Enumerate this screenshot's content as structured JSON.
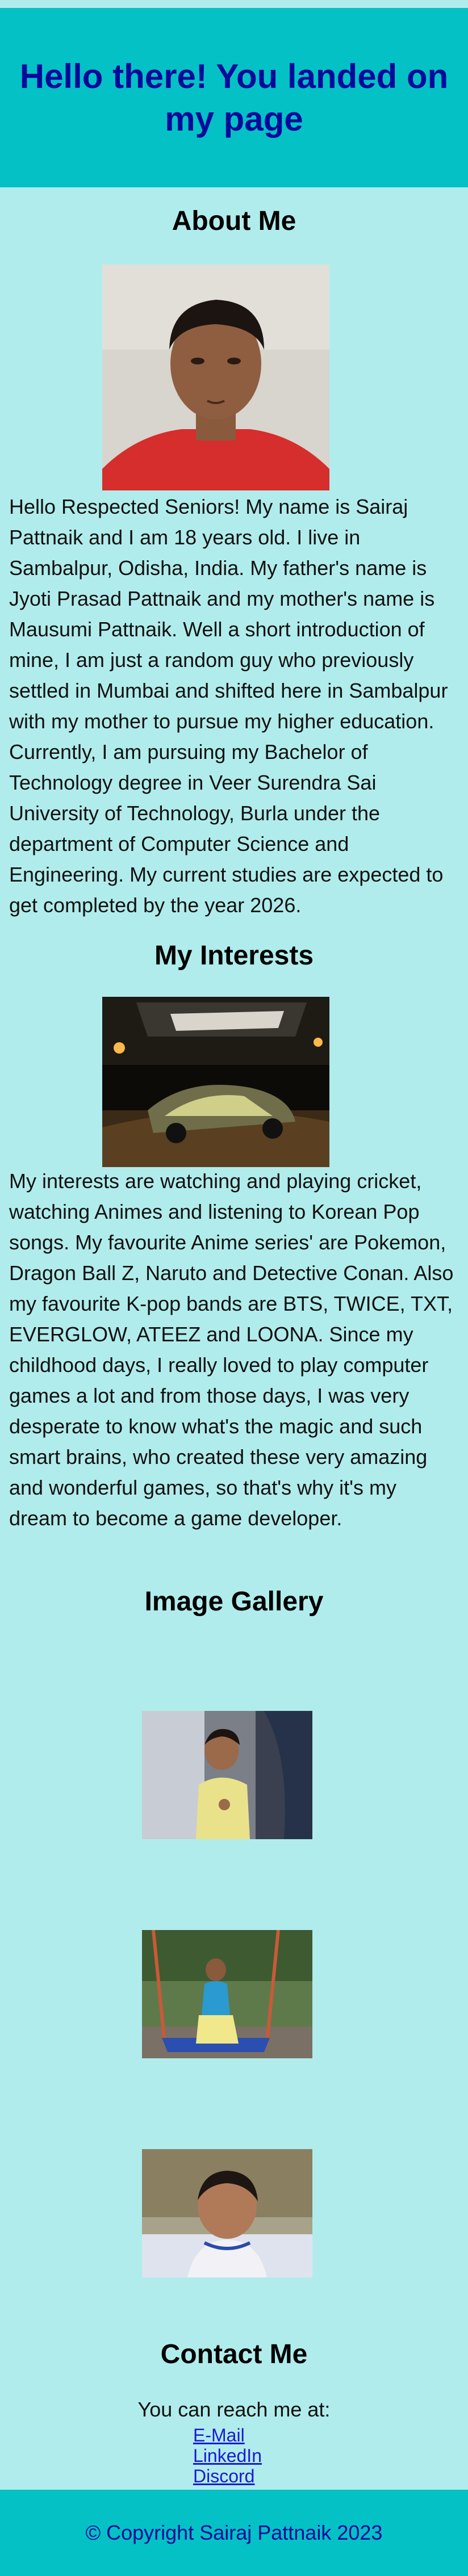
{
  "header": {
    "title": "Hello there! You landed on my page"
  },
  "about": {
    "heading": "About Me",
    "text": "Hello Respected Seniors! My name is Sairaj Pattnaik and I am 18 years old. I live in Sambalpur, Odisha, India. My father's name is Jyoti Prasad Pattnaik and my mother's name is Mausumi Pattnaik. Well a short introduction of mine, I am just a random guy who previously settled in Mumbai and shifted here in Sambalpur with my mother to pursue my higher education. Currently, I am pursuing my Bachelor of Technology degree in Veer Surendra Sai University of Technology, Burla under the department of Computer Science and Engineering. My current studies are expected to get completed by the year 2026."
  },
  "interests": {
    "heading": "My Interests",
    "text": "My interests are watching and playing cricket, watching Animes and listening to Korean Pop songs. My favourite Anime series' are Pokemon, Dragon Ball Z, Naruto and Detective Conan. Also my favourite K-pop bands are BTS, TWICE, TXT, EVERGLOW, ATEEZ and LOONA. Since my childhood days, I really loved to play computer games a lot and from those days, I was very desperate to know what's the magic and such smart brains, who created these very amazing and wonderful games, so that's why it's my dream to become a game developer."
  },
  "gallery": {
    "heading": "Image Gallery"
  },
  "contact": {
    "heading": "Contact Me",
    "intro": "You can reach me at:",
    "links": [
      "E-Mail",
      "LinkedIn",
      "Discord"
    ]
  },
  "footer": {
    "text": "© Copyright Sairaj Pattnaik 2023"
  },
  "colors": {
    "background": "#b1ecec",
    "banner": "#04c1c5",
    "banner_text": "#000a9b",
    "link": "#1a1ad6"
  }
}
